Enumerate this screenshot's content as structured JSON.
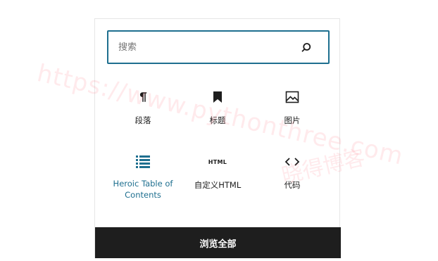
{
  "search": {
    "placeholder": "搜索"
  },
  "blocks": [
    {
      "label": "段落",
      "icon": "paragraph-icon"
    },
    {
      "label": "标题",
      "icon": "bookmark-icon"
    },
    {
      "label": "图片",
      "icon": "image-icon"
    },
    {
      "label": "Heroic Table of Contents",
      "icon": "list-icon"
    },
    {
      "label": "自定义HTML",
      "icon": "html-icon",
      "icon_text": "HTML"
    },
    {
      "label": "代码",
      "icon": "code-icon"
    }
  ],
  "browse_all": {
    "label": "浏览全部"
  },
  "watermark": {
    "url": "https://www.pythonthree.com",
    "site": "晓得博客"
  },
  "colors": {
    "accent": "#1e6f8f",
    "dark": "#1e1e1e",
    "watermark": "#ff5a6e"
  }
}
